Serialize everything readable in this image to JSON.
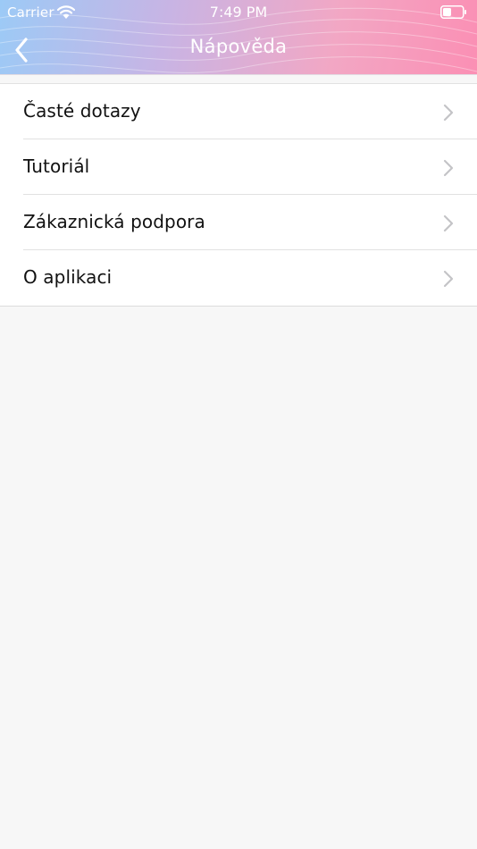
{
  "status_bar": {
    "carrier": "Carrier",
    "time": "7:49 PM",
    "icons": [
      "wifi-icon",
      "battery-icon"
    ]
  },
  "nav": {
    "title": "Nápověda",
    "back_icon": "chevron-left-icon"
  },
  "menu": {
    "items": [
      {
        "label": "Časté dotazy",
        "icon": "chevron-right-icon"
      },
      {
        "label": "Tutoriál",
        "icon": "chevron-right-icon"
      },
      {
        "label": "Zákaznická podpora",
        "icon": "chevron-right-icon"
      },
      {
        "label": "O aplikaci",
        "icon": "chevron-right-icon"
      }
    ]
  },
  "colors": {
    "header_gradient_start": "#9ccaf6",
    "header_gradient_mid": "#c8b4e4",
    "header_gradient_end": "#fb8fb4",
    "background": "#f7f7f7",
    "list_background": "#ffffff",
    "text": "#111111",
    "chevron": "#c4c4c7"
  }
}
